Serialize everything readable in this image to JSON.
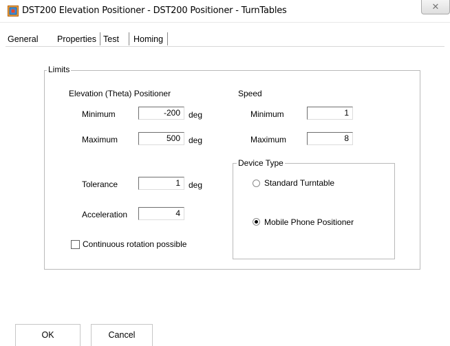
{
  "window": {
    "title": "DST200 Elevation Positioner - DST200 Positioner - TurnTables",
    "close_glyph": "✕"
  },
  "tabs": [
    {
      "label": "General",
      "active": false
    },
    {
      "label": "Properties",
      "active": true
    },
    {
      "label": "Test",
      "active": false
    },
    {
      "label": "Homing",
      "active": false
    }
  ],
  "limits": {
    "legend": "Limits",
    "positioner_heading": "Elevation (Theta) Positioner",
    "min_label": "Minimum",
    "min_value": "-200",
    "max_label": "Maximum",
    "max_value": "500",
    "unit": "deg",
    "tolerance_label": "Tolerance",
    "tolerance_value": "1",
    "acceleration_label": "Acceleration",
    "acceleration_value": "4",
    "continuous_label": "Continuous rotation possible",
    "continuous_checked": false
  },
  "speed": {
    "heading": "Speed",
    "min_label": "Minimum",
    "min_value": "1",
    "max_label": "Maximum",
    "max_value": "8"
  },
  "device_type": {
    "legend": "Device Type",
    "options": [
      {
        "label": "Standard Turntable",
        "checked": false
      },
      {
        "label": "Mobile Phone Positioner",
        "checked": true
      }
    ]
  },
  "buttons": {
    "ok_label": "OK",
    "cancel_label": "Cancel"
  }
}
